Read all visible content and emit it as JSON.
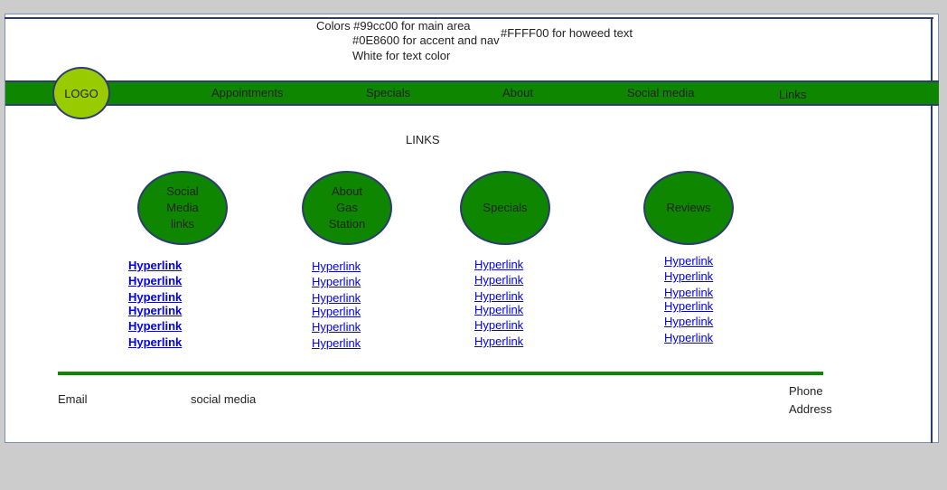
{
  "notes": {
    "line1": "Colors #99cc00 for main area",
    "line2": "#0E8600 for accent and nav",
    "line3": "White for text color",
    "highlight": "#FFFF00 for howeed text"
  },
  "logo": {
    "label": "LOGO"
  },
  "nav": {
    "items": [
      {
        "label": "Appointments"
      },
      {
        "label": "Specials"
      },
      {
        "label": "About"
      },
      {
        "label": "Social media"
      },
      {
        "label": "Links"
      }
    ]
  },
  "section": {
    "title": "LINKS"
  },
  "columns": [
    {
      "circle_lines": [
        "Social",
        "Media",
        "links"
      ],
      "links": [
        "Hyperlink",
        "Hyperlink",
        "Hyperlink",
        "Hyperlink",
        "Hyperlink",
        "Hyperlink"
      ]
    },
    {
      "circle_lines": [
        "About",
        "Gas",
        "Station"
      ],
      "links": [
        "Hyperlink",
        "Hyperlink",
        "Hyperlink",
        "Hyperlink",
        "Hyperlink",
        "Hyperlink"
      ]
    },
    {
      "circle_lines": [
        "Specials"
      ],
      "links": [
        "Hyperlink",
        "Hyperlink",
        "Hyperlink",
        "Hyperlink",
        "Hyperlink",
        "Hyperlink"
      ]
    },
    {
      "circle_lines": [
        "Reviews"
      ],
      "links": [
        "Hyperlink",
        "Hyperlink",
        "Hyperlink",
        "Hyperlink",
        "Hyperlink",
        "Hyperlink"
      ]
    }
  ],
  "footer": {
    "email": "Email",
    "social": "social media",
    "phone": "Phone",
    "address": "Address"
  },
  "colors": {
    "main": "#99cc00",
    "accent": "#0E8600",
    "highlight": "#FFFF00",
    "frame": "#2b3d6e",
    "link": "#0000ee"
  }
}
